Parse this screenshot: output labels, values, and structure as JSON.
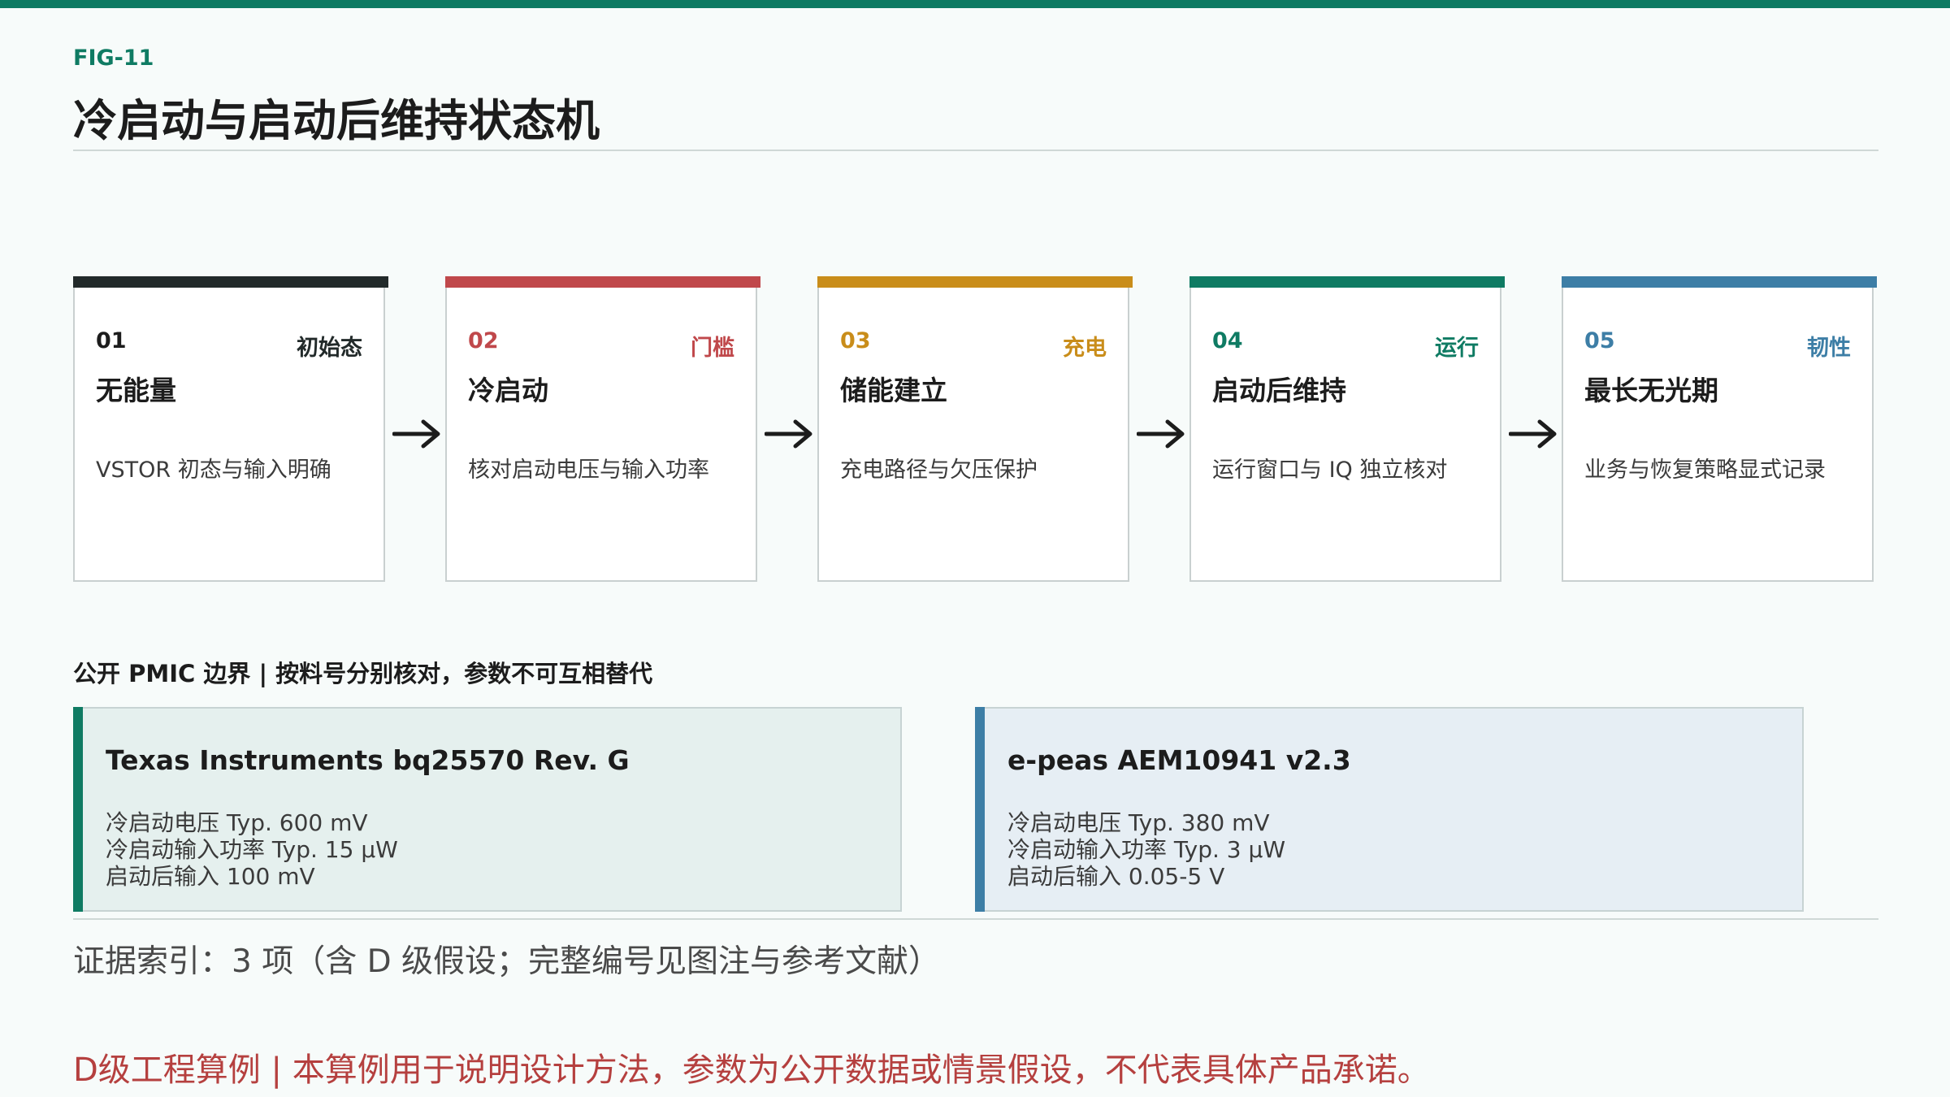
{
  "header": {
    "fig_label": "FIG-11",
    "title": "冷启动与启动后维持状态机"
  },
  "states": [
    {
      "num": "01",
      "tag": "初始态",
      "name": "无能量",
      "desc": "VSTOR 初态与输入明确",
      "color": "#222a2a"
    },
    {
      "num": "02",
      "tag": "门槛",
      "name": "冷启动",
      "desc": "核对启动电压与输入功率",
      "color": "#c0484b"
    },
    {
      "num": "03",
      "tag": "充电",
      "name": "储能建立",
      "desc": "充电路径与欠压保护",
      "color": "#c98d1a"
    },
    {
      "num": "04",
      "tag": "运行",
      "name": "启动后维持",
      "desc": "运行窗口与 IQ 独立核对",
      "color": "#0f7b63"
    },
    {
      "num": "05",
      "tag": "韧性",
      "name": "最长无光期",
      "desc": "业务与恢复策略显式记录",
      "color": "#3d7ea6"
    }
  ],
  "section_title": "公开 PMIC 边界 | 按料号分别核对，参数不可互相替代",
  "chips": [
    {
      "name": "Texas Instruments bq25570 Rev. G",
      "specs": [
        "冷启动电压 Typ. 600 mV",
        "冷启动输入功率 Typ. 15 µW",
        "启动后输入 100 mV"
      ],
      "accent": "#0f7b63",
      "bg": "#e5f0ee"
    },
    {
      "name": "e-peas AEM10941 v2.3",
      "specs": [
        "冷启动电压 Typ. 380 mV",
        "冷启动输入功率 Typ. 3 µW",
        "启动后输入 0.05-5 V"
      ],
      "accent": "#3d7ea6",
      "bg": "#e6eef4"
    }
  ],
  "evidence": "证据索引：3 项（含 D 级假设；完整编号见图注与参考文献）",
  "disclaimer": "D级工程算例 | 本算例用于说明设计方法，参数为公开数据或情景假设，不代表具体产品承诺。"
}
